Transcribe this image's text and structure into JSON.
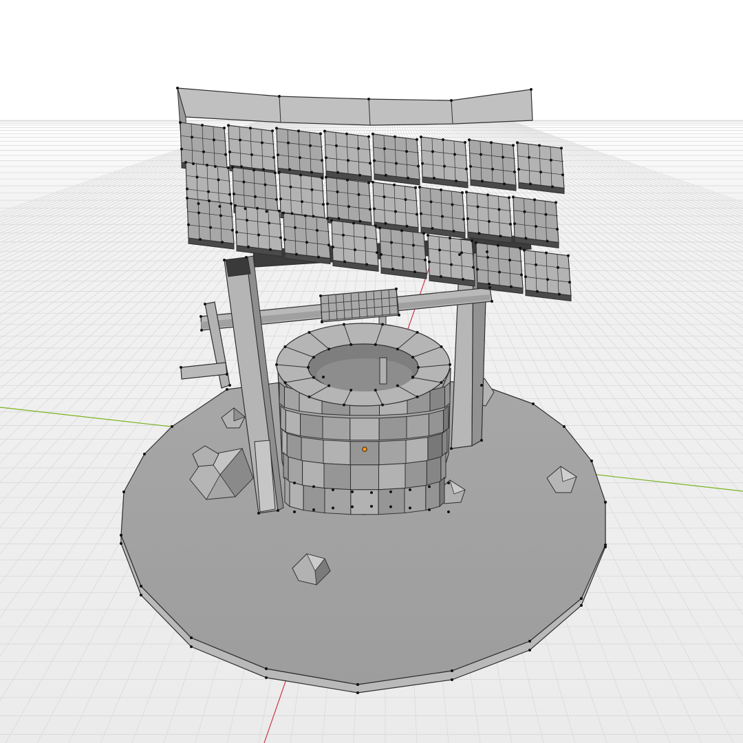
{
  "viewport": {
    "mode": "edit",
    "shading": "solid",
    "overlays": {
      "grid_floor": true,
      "axis_x_line": true,
      "axis_y_line": true,
      "vertices": true
    },
    "colors": {
      "background": "#ffffff",
      "grid_line": "#d6d6d6",
      "axis_x": "#c8374c",
      "axis_y": "#7ab21e",
      "mesh_light": "#b8b8b8",
      "mesh_mid": "#9a9a9a",
      "mesh_dark": "#6e6e6e",
      "mesh_edge": "#2e2e2e",
      "vertex": "#111111",
      "origin": "#ff9a1f"
    }
  },
  "scene": {
    "object": "wishing-well",
    "parts": [
      "roof",
      "shingles",
      "roof-beam",
      "left-post",
      "right-post",
      "crank-axle",
      "rope-drum",
      "crank-handle",
      "well-body",
      "base-platform",
      "rocks"
    ],
    "origin_marker": "origin-point"
  }
}
